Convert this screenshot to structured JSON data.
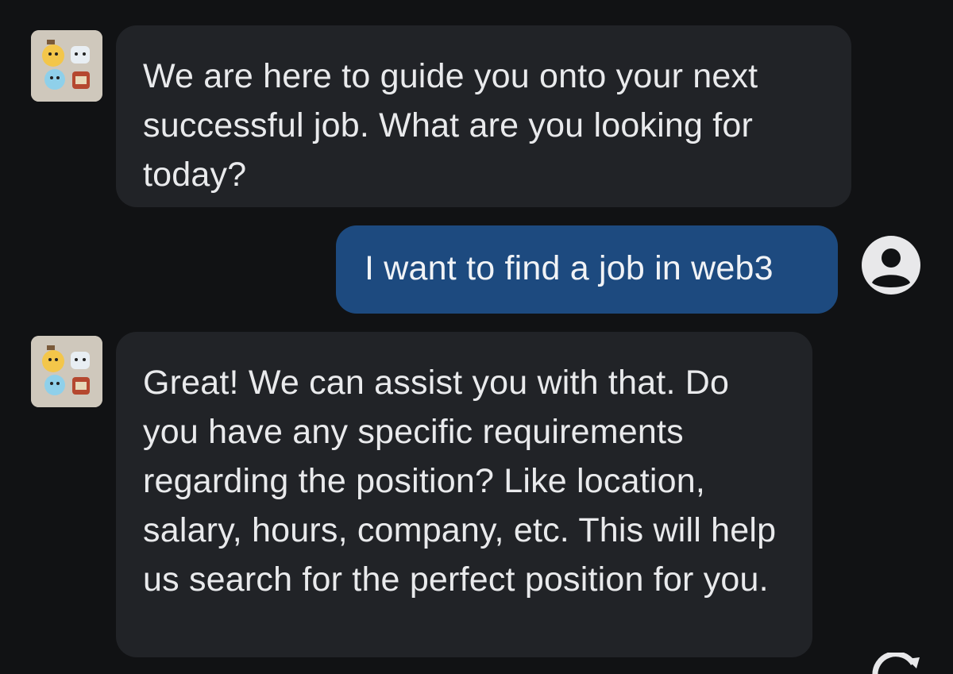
{
  "chat": {
    "messages": [
      {
        "sender": "bot",
        "text": "We are here to guide you onto your next successful job. What are you looking for today?"
      },
      {
        "sender": "user",
        "text": "I want to find a job in web3"
      },
      {
        "sender": "bot",
        "text": "Great! We can assist you with that. Do you have any specific requirements regarding the position? Like location, salary, hours, company, etc. This will help us search for the perfect position for you."
      }
    ]
  },
  "icons": {
    "bot_avatar": "bot-avatar-illustration",
    "user_avatar": "user-circle-icon",
    "corner": "refresh-icon"
  },
  "colors": {
    "background": "#111214",
    "bot_bubble": "#212327",
    "user_bubble": "#1d4a7f",
    "text": "#e9eaec"
  }
}
